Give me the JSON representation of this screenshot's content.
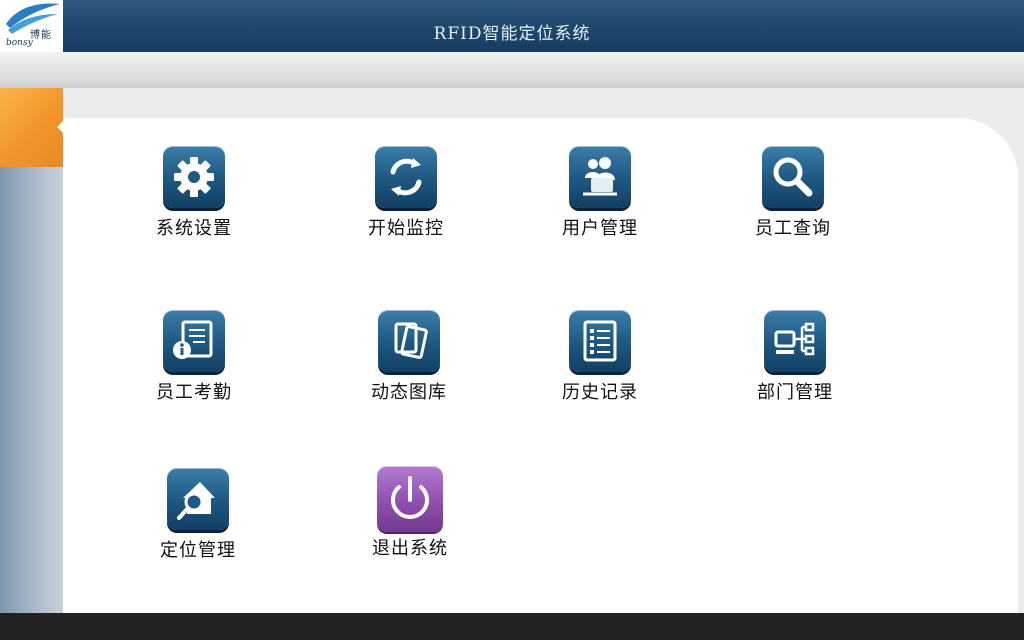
{
  "header": {
    "title": "RFID智能定位系统",
    "logo_text": "博能",
    "logo_sub": "bonsy"
  },
  "menu": {
    "items": [
      {
        "label": "系统设置",
        "icon": "gear-icon"
      },
      {
        "label": "开始监控",
        "icon": "refresh-icon"
      },
      {
        "label": "用户管理",
        "icon": "users-icon"
      },
      {
        "label": "员工查询",
        "icon": "search-icon"
      },
      {
        "label": "员工考勤",
        "icon": "info-document-icon"
      },
      {
        "label": "动态图库",
        "icon": "cards-icon"
      },
      {
        "label": "历史记录",
        "icon": "list-icon"
      },
      {
        "label": "部门管理",
        "icon": "org-chart-icon"
      },
      {
        "label": "定位管理",
        "icon": "location-search-icon"
      },
      {
        "label": "退出系统",
        "icon": "power-icon"
      }
    ]
  },
  "colors": {
    "header_bg": "#1f4a70",
    "tile_blue": "#1f5a84",
    "tile_purple": "#8e50b0",
    "accent_orange": "#f1952a"
  }
}
